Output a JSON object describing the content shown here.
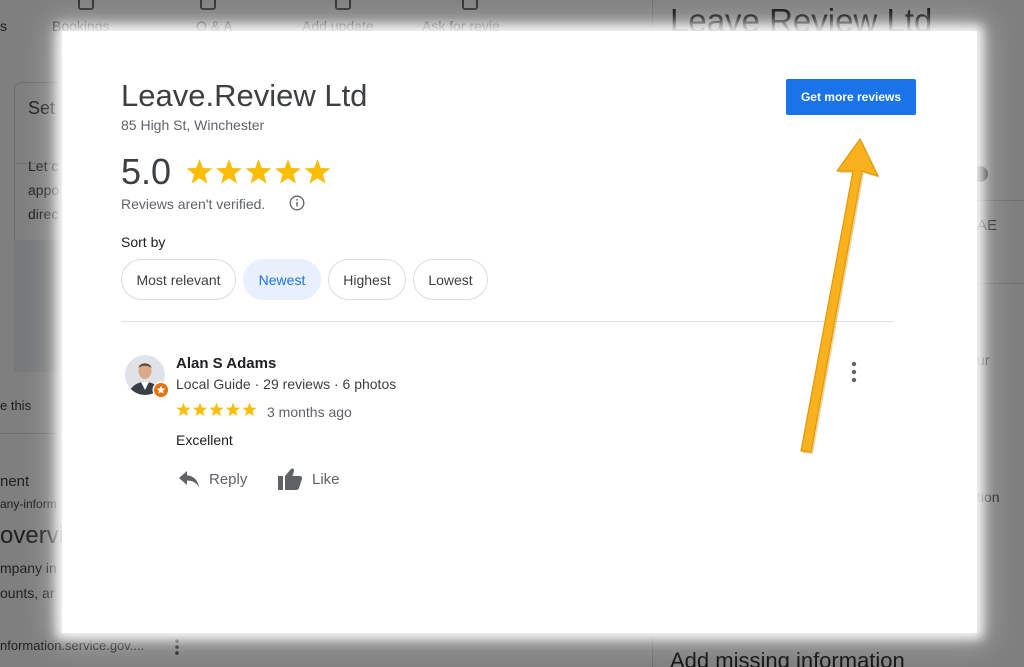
{
  "background_page": {
    "top_tabs": [
      "s",
      "Bookings",
      "Q & A",
      "Add update",
      "Ask for revie"
    ],
    "right_title": "Leave Review Ltd",
    "left_fragments": [
      "Set",
      "Let c",
      "appo",
      "direc",
      "e this",
      "nent",
      "any-inform",
      "overvi",
      "mpany in",
      "ounts, ar",
      "nformation.service.gov...."
    ],
    "right_fragments": [
      "AE",
      "ur",
      "tion",
      "Add missing information"
    ]
  },
  "business": {
    "name": "Leave.Review Ltd",
    "address": "85 High St, Winchester",
    "rating": "5.0",
    "rating_stars": 5,
    "unverified_note": "Reviews aren't verified."
  },
  "sort": {
    "label": "Sort by",
    "options": [
      "Most relevant",
      "Newest",
      "Highest",
      "Lowest"
    ],
    "selected": "Newest"
  },
  "get_more_button": "Get more reviews",
  "review": {
    "author": "Alan S Adams",
    "meta": "Local Guide · 29 reviews · 6 photos",
    "stars": 5,
    "time": "3 months ago",
    "text": "Excellent",
    "reply_label": "Reply",
    "like_label": "Like"
  },
  "colors": {
    "accent": "#1a73e8",
    "star": "#fbbc04",
    "annotation_arrow": "#f9b21d",
    "chip_active_bg": "#e8f0fe"
  },
  "icons": [
    "info-icon",
    "reply-icon",
    "thumbs-up-icon",
    "more-vert-icon",
    "star-icon",
    "local-guide-badge-icon"
  ]
}
